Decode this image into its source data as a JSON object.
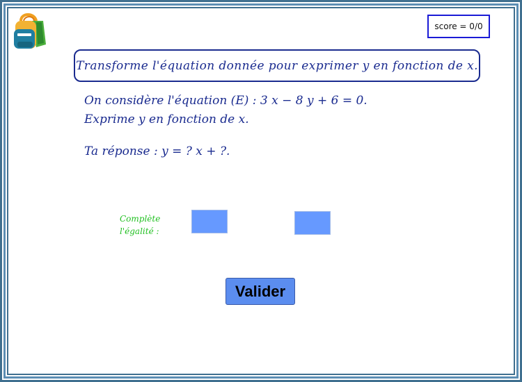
{
  "score": {
    "label": "score = 0/0"
  },
  "instruction": "Transforme l'équation donnée pour exprimer y en fonction de x.",
  "statement": {
    "line1": "On considère l'équation (E) : 3 x − 8 y + 6 = 0.",
    "line2": "Exprime y en fonction de x."
  },
  "answer_prompt": "Ta réponse :  y = ? x + ?.",
  "complete": {
    "line1": "Complète",
    "line2": "l'égalité :"
  },
  "fields": [
    {
      "value": ""
    },
    {
      "value": ""
    }
  ],
  "validate_button": {
    "label": "Valider"
  },
  "colors": {
    "frame": "#3f6f8f",
    "text_blue": "#1a2b8f",
    "label_green": "#22c022",
    "field_fill": "#6699ff",
    "button_fill": "#5b8def"
  },
  "icons": {
    "logo": "backpack-icon"
  }
}
